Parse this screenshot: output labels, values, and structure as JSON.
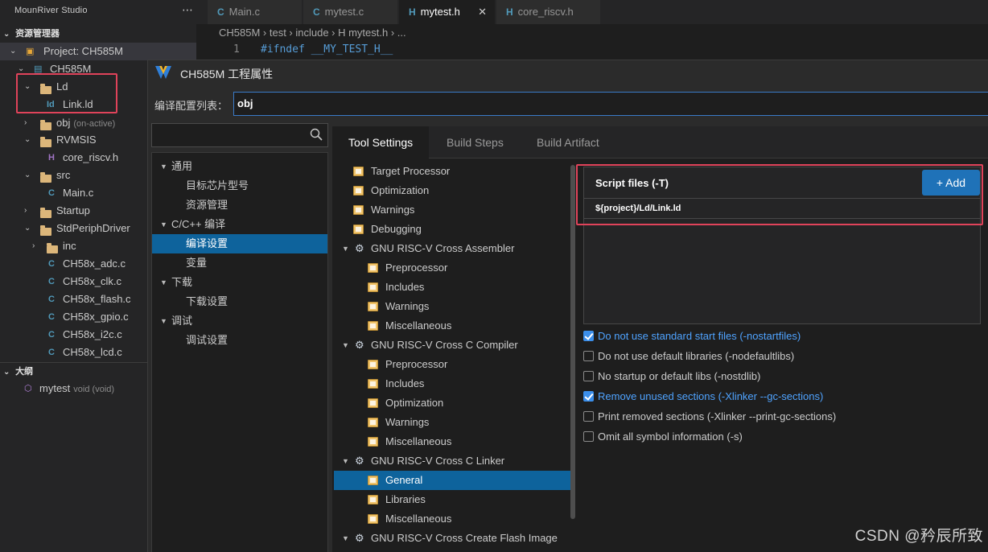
{
  "app": {
    "title": "MounRiver Studio"
  },
  "sidebar": {
    "explorer_title": "资源管理器",
    "project": "Project: CH585M",
    "items": [
      {
        "label": "CH585M"
      },
      {
        "label": "Ld"
      },
      {
        "label": "Link.ld",
        "icon": "Id"
      },
      {
        "label": "obj",
        "note": "(on-active)"
      },
      {
        "label": "RVMSIS"
      },
      {
        "label": "core_riscv.h",
        "icon": "H"
      },
      {
        "label": "src"
      },
      {
        "label": "Main.c",
        "icon": "C"
      },
      {
        "label": "Startup"
      },
      {
        "label": "StdPeriphDriver"
      },
      {
        "label": "inc"
      },
      {
        "label": "CH58x_adc.c",
        "icon": "C"
      },
      {
        "label": "CH58x_clk.c",
        "icon": "C"
      },
      {
        "label": "CH58x_flash.c",
        "icon": "C"
      },
      {
        "label": "CH58x_gpio.c",
        "icon": "C"
      },
      {
        "label": "CH58x_i2c.c",
        "icon": "C"
      },
      {
        "label": "CH58x_lcd.c",
        "icon": "C"
      }
    ],
    "outline_title": "大纲",
    "outline_item": "mytest",
    "outline_item_sig": "void (void)"
  },
  "editor": {
    "tabs": [
      {
        "icon": "C",
        "label": "Main.c"
      },
      {
        "icon": "C",
        "label": "mytest.c"
      },
      {
        "icon": "H",
        "label": "mytest.h",
        "close": "✕"
      },
      {
        "icon": "H",
        "label": "core_riscv.h"
      }
    ],
    "breadcrumb": "CH585M › test › include › H mytest.h › ...",
    "line_number": "1",
    "code_line": "#ifndef __MY_TEST_H__"
  },
  "dialog": {
    "title": "CH585M 工程属性",
    "config_label": "编译配置列表：",
    "config_value": "obj",
    "nav": [
      {
        "label": "通用",
        "tri": "▼"
      },
      {
        "label": "目标芯片型号"
      },
      {
        "label": "资源管理"
      },
      {
        "label": "C/C++ 编译",
        "tri": "▼"
      },
      {
        "label": "编译设置"
      },
      {
        "label": "变量"
      },
      {
        "label": "下载",
        "tri": "▼"
      },
      {
        "label": "下载设置"
      },
      {
        "label": "调试",
        "tri": "▼"
      },
      {
        "label": "调试设置"
      }
    ],
    "tabs": [
      "Tool Settings",
      "Build Steps",
      "Build Artifact"
    ],
    "tool_tree": [
      {
        "label": "Target Processor"
      },
      {
        "label": "Optimization"
      },
      {
        "label": "Warnings"
      },
      {
        "label": "Debugging"
      },
      {
        "label": "GNU RISC-V Cross Assembler",
        "tri": "▼"
      },
      {
        "label": "Preprocessor"
      },
      {
        "label": "Includes"
      },
      {
        "label": "Warnings"
      },
      {
        "label": "Miscellaneous"
      },
      {
        "label": "GNU RISC-V Cross C Compiler",
        "tri": "▼"
      },
      {
        "label": "Preprocessor"
      },
      {
        "label": "Includes"
      },
      {
        "label": "Optimization"
      },
      {
        "label": "Warnings"
      },
      {
        "label": "Miscellaneous"
      },
      {
        "label": "GNU RISC-V Cross C Linker",
        "tri": "▼"
      },
      {
        "label": "General"
      },
      {
        "label": "Libraries"
      },
      {
        "label": "Miscellaneous"
      },
      {
        "label": "GNU RISC-V Cross Create Flash Image",
        "tri": "▼"
      }
    ],
    "script": {
      "header": "Script files (-T)",
      "add_label": "+ Add",
      "entry": "${project}/Ld/Link.ld"
    },
    "options": [
      {
        "label": "Do not use standard start files (-nostartfiles)",
        "checked": true
      },
      {
        "label": "Do not use default libraries (-nodefaultlibs)",
        "checked": false
      },
      {
        "label": "No startup or default libs (-nostdlib)",
        "checked": false
      },
      {
        "label": "Remove unused sections (-Xlinker --gc-sections)",
        "checked": true
      },
      {
        "label": "Print removed sections (-Xlinker --print-gc-sections)",
        "checked": false
      },
      {
        "label": "Omit all symbol information (-s)",
        "checked": false
      }
    ]
  },
  "watermark": "CSDN @矜辰所致",
  "colors": {
    "accent": "#0e639c",
    "button": "#1f72b8",
    "highlight": "#e0435a",
    "checked_text": "#4fa3ff"
  }
}
